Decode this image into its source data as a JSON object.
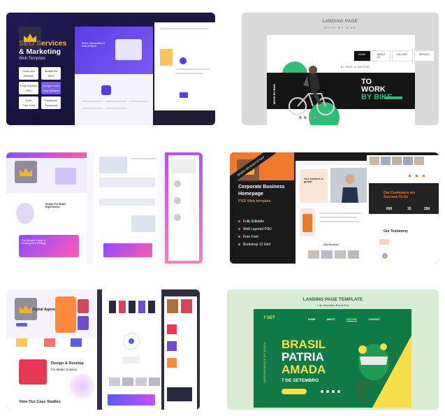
{
  "gallery": {
    "cards": [
      {
        "id": "seo-services",
        "title_line1": "SEO Services",
        "title_line2": "& Marketing",
        "subtitle": "Web Template",
        "features": [
          {
            "top": "Grow your",
            "bottom": "Website"
          },
          {
            "top": "Always the",
            "bottom": "SEO"
          },
          {
            "top": "Fully Editable",
            "bottom": "PSD"
          },
          {
            "top": "Google Fonts",
            "bottom": "Grid included"
          },
          {
            "top": "Free",
            "bottom": "Free Font"
          },
          {
            "top": "Download",
            "bottom": "Download"
          }
        ],
        "hero_text": "Better Optimization & Data Analysis"
      },
      {
        "id": "to-work-by-bike",
        "header_title": "LANDING PAGE",
        "header_subtitle": "MOVE BY BIKE",
        "nav": [
          "HOME",
          "ABOUT US",
          "GALLERY",
          "SERVICE"
        ],
        "nav_active": "HOME",
        "headline_line1": "TO",
        "headline_line2": "WORK",
        "headline_line3": "BY BIKE",
        "tagline": "BY BIKE IS BETTER",
        "side_label": "MOVE BY BIKE"
      },
      {
        "id": "digital-agency-purple",
        "headline": "Design For Better Experiences",
        "cta_text": "Get Website Design & Development Strategy"
      },
      {
        "id": "corporate-business",
        "ribbon": "BASED ON BOOTSTRAP",
        "title_line1": "Corporate Business",
        "title_line2": "Homepage",
        "subtitle": "PSD Web template",
        "features": [
          "Fully Editable",
          "Well Layered PSD",
          "Free Font",
          "Bootstrap 12 Grid"
        ],
        "hero_text": "Your business is growth",
        "stats": [
          "650",
          "15",
          "250"
        ],
        "section_testimony": "Our Testimony",
        "section_services": "Our Services",
        "cta_text": "Our Customers are Success To Us"
      },
      {
        "id": "digital-agency-studio",
        "headline": "Digital Agency",
        "design_line1": "Design & Develop",
        "design_line2": "For Better Solution",
        "studio_text": "View Our Case Studies"
      },
      {
        "id": "brasil-patria-amada",
        "header_title": "LANDING PAGE TEMPLATE",
        "header_subtitle": "7 de Setembro Event Flux",
        "logo_text": "7 SET",
        "nav": [
          "HOME",
          "ABOUT",
          "HISTORY",
          "CONTACT"
        ],
        "nav_active": "HISTORY",
        "line1": "BRASIL",
        "line2": "PATRIA",
        "line3": "AMADA",
        "date": "7 DE SETEMBRO",
        "side_text": "INDEPENDENCIA DO BRASIL"
      }
    ],
    "colors": {
      "seo_dark": "#1b1642",
      "seo_accent": "#ffb64a",
      "bike_green": "#2ebd72",
      "corp_orange": "#ef7a2e",
      "brasil_green": "#0f7a45",
      "brasil_yellow": "#f8e04a"
    },
    "icons": [
      "crown-icon"
    ]
  }
}
